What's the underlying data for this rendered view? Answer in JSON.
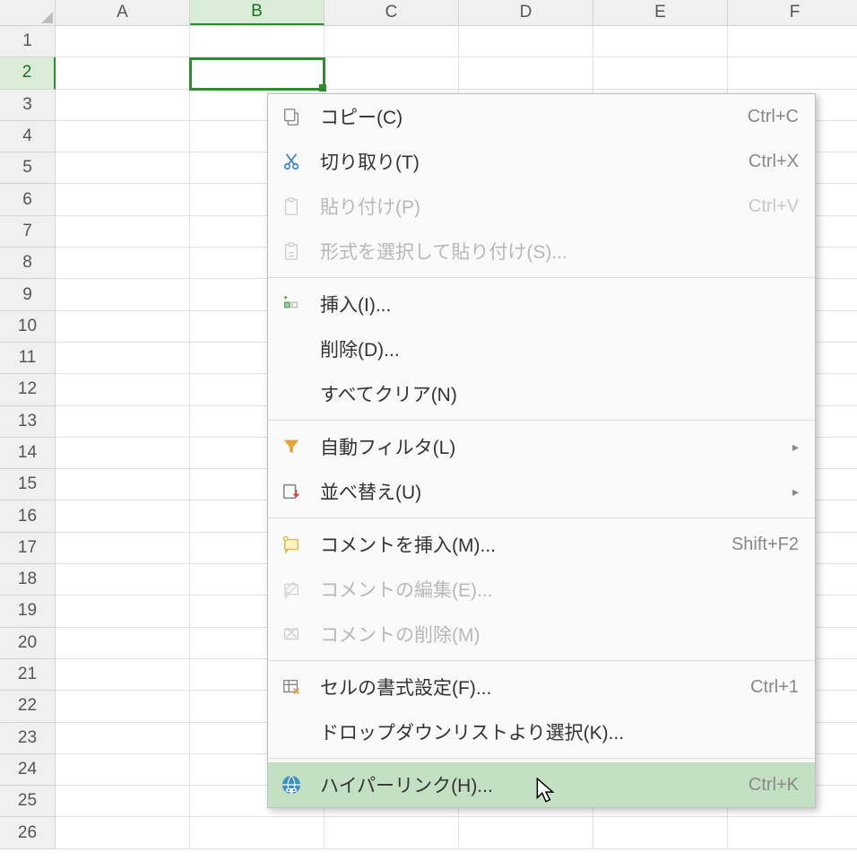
{
  "columns": [
    "A",
    "B",
    "C",
    "D",
    "E",
    "F"
  ],
  "selected_column": "B",
  "rows": [
    1,
    2,
    3,
    4,
    5,
    6,
    7,
    8,
    9,
    10,
    11,
    12,
    13,
    14,
    15,
    16,
    17,
    18,
    19,
    20,
    21,
    22,
    23,
    24,
    25,
    26
  ],
  "selected_row": 2,
  "menu": {
    "copy": {
      "label": "コピー(C)",
      "shortcut": "Ctrl+C"
    },
    "cut": {
      "label": "切り取り(T)",
      "shortcut": "Ctrl+X"
    },
    "paste": {
      "label": "貼り付け(P)",
      "shortcut": "Ctrl+V"
    },
    "paste_sp": {
      "label": "形式を選択して貼り付け(S)..."
    },
    "insert": {
      "label": "挿入(I)..."
    },
    "delete": {
      "label": "削除(D)..."
    },
    "clear": {
      "label": "すべてクリア(N)"
    },
    "autofilter": {
      "label": "自動フィルタ(L)"
    },
    "sort": {
      "label": "並べ替え(U)"
    },
    "ins_comment": {
      "label": "コメントを挿入(M)...",
      "shortcut": "Shift+F2"
    },
    "edit_comment": {
      "label": "コメントの編集(E)..."
    },
    "del_comment": {
      "label": "コメントの削除(M)"
    },
    "format_cells": {
      "label": "セルの書式設定(F)...",
      "shortcut": "Ctrl+1"
    },
    "dropdown": {
      "label": "ドロップダウンリストより選択(K)..."
    },
    "hyperlink": {
      "label": "ハイパーリンク(H)...",
      "shortcut": "Ctrl+K"
    }
  }
}
